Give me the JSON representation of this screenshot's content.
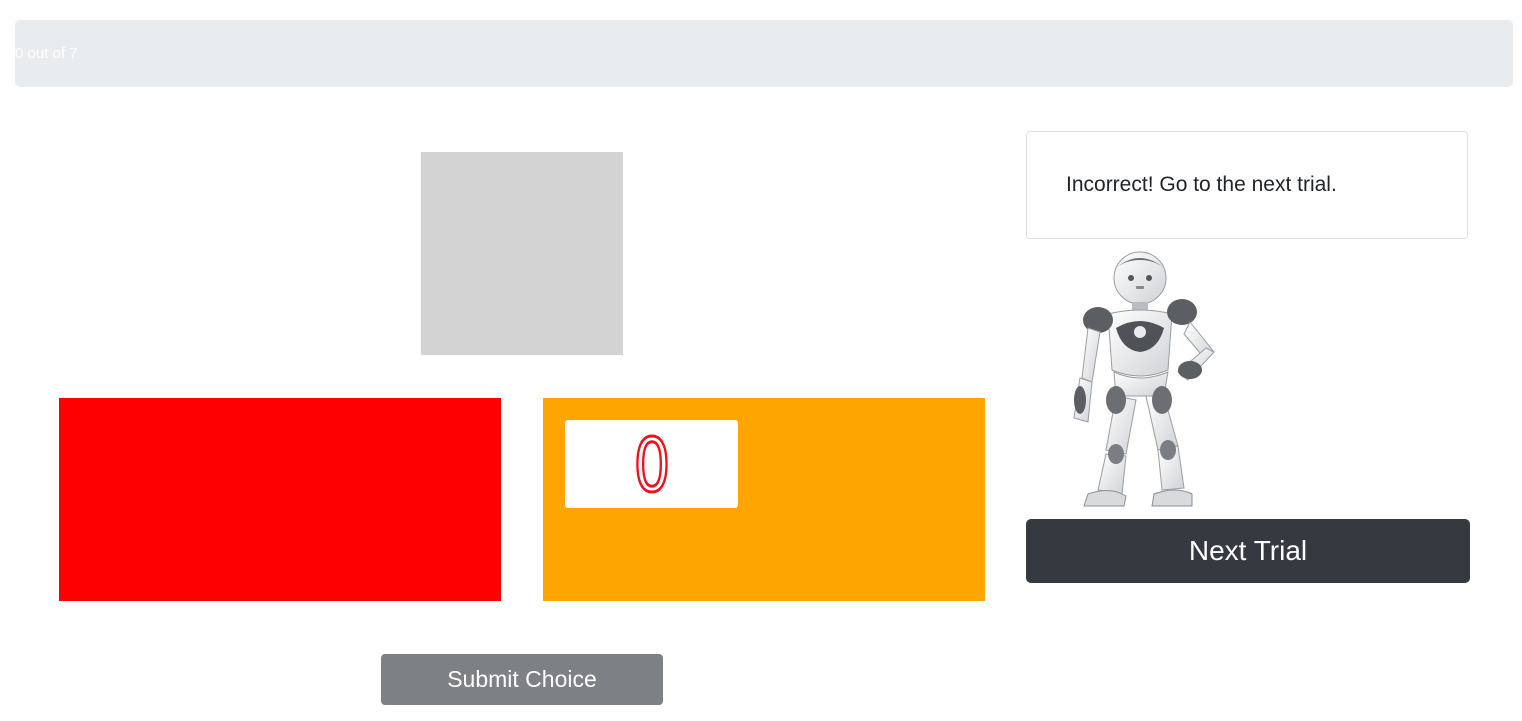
{
  "progress": {
    "label": "0 out of 7",
    "completed": 0,
    "total": 7
  },
  "stimulus": {
    "color": "#d3d3d3"
  },
  "choices": {
    "left": {
      "color": "#ff0000"
    },
    "right": {
      "color": "#ffa500",
      "digit": "0",
      "digit_color": "#e8141e"
    }
  },
  "submit": {
    "label": "Submit Choice",
    "color": "#7d8084"
  },
  "feedback": {
    "message": "Incorrect! Go to the next trial."
  },
  "robot": {
    "icon": "humanoid-robot-icon"
  },
  "next": {
    "label": "Next Trial",
    "color": "#343a40"
  }
}
